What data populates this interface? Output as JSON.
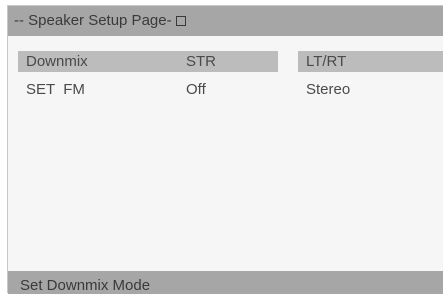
{
  "header": {
    "title": "-- Speaker Setup Page-"
  },
  "settings": [
    {
      "label": "Downmix",
      "value": "STR"
    },
    {
      "label": "SET  FM",
      "value": "Off"
    }
  ],
  "options": [
    {
      "label": "LT/RT"
    },
    {
      "label": "Stereo"
    }
  ],
  "status": {
    "text": "Set Downmix Mode"
  },
  "colors": {
    "background": "#f6f6f6",
    "bar": "#a6a6a6",
    "highlight": "#bcbcbc",
    "text": "#4a4a4a"
  }
}
